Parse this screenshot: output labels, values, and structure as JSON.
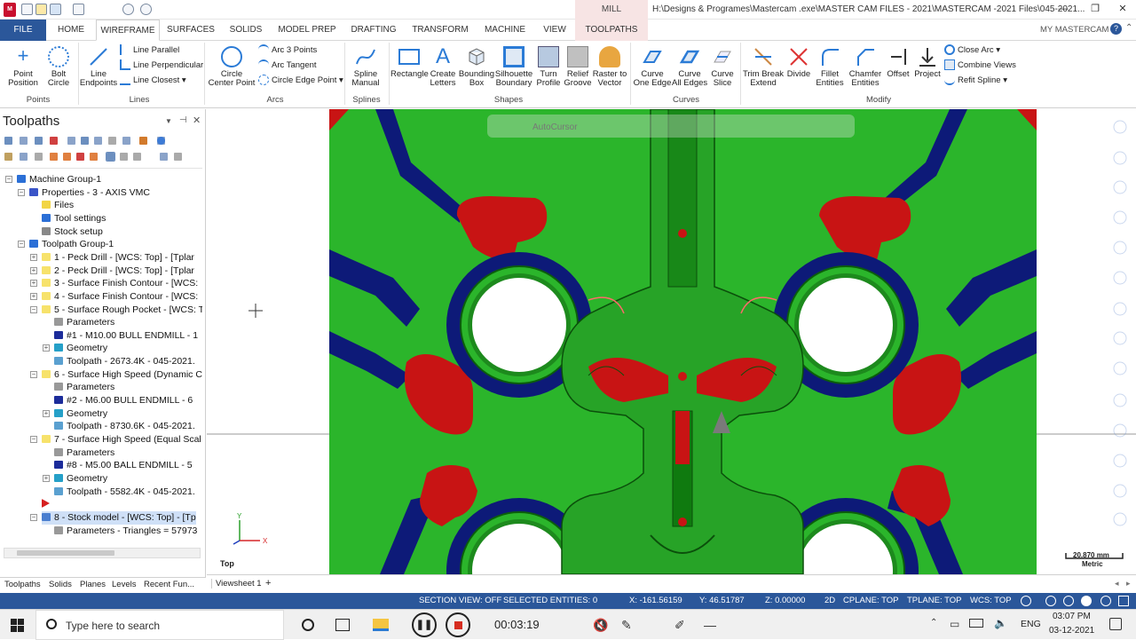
{
  "window": {
    "context_tab": "MILL",
    "title": "H:\\Designs & Programes\\Mastercam .exe\\MASTER CAM FILES - 2021\\MASTERCAM   -2021 Files\\045-2021...",
    "my_mastercam": "MY MASTERCAM"
  },
  "tabs": [
    "FILE",
    "HOME",
    "WIREFRAME",
    "SURFACES",
    "SOLIDS",
    "MODEL PREP",
    "DRAFTING",
    "TRANSFORM",
    "MACHINE",
    "VIEW",
    "TOOLPATHS"
  ],
  "ribbon": {
    "points": {
      "point_position": "Point\nPosition",
      "bolt_circle": "Bolt\nCircle",
      "group": "Points"
    },
    "lines": {
      "line_endpoints": "Line\nEndpoints",
      "line_parallel": "Line Parallel",
      "line_perpendicular": "Line Perpendicular",
      "line_closest": "Line Closest",
      "group": "Lines"
    },
    "arcs": {
      "circle_center_point": "Circle\nCenter Point",
      "arc_3_points": "Arc 3 Points",
      "arc_tangent": "Arc Tangent",
      "circle_edge_point": "Circle Edge Point",
      "group": "Arcs"
    },
    "splines": {
      "spline_manual": "Spline\nManual",
      "group": "Splines"
    },
    "shapes": {
      "rectangle": "Rectangle",
      "create_letters": "Create\nLetters",
      "bounding_box": "Bounding\nBox",
      "silhouette_boundary": "Silhouette\nBoundary",
      "turn_profile": "Turn\nProfile",
      "relief_groove": "Relief\nGroove",
      "raster_to_vector": "Raster to\nVector",
      "group": "Shapes"
    },
    "curves": {
      "curve_one_edge": "Curve\nOne Edge",
      "curve_all_edges": "Curve\nAll Edges",
      "curve_slice": "Curve\nSlice",
      "group": "Curves"
    },
    "modify": {
      "trim_break_extend": "Trim Break\nExtend",
      "divide": "Divide",
      "fillet_entities": "Fillet\nEntities",
      "chamfer_entities": "Chamfer\nEntities",
      "offset": "Offset",
      "project": "Project",
      "close_arc": "Close Arc",
      "combine_views": "Combine Views",
      "refit_spline": "Refit Spline",
      "group": "Modify"
    }
  },
  "panel": {
    "title": "Toolpaths",
    "tree": [
      {
        "label": "Machine Group-1",
        "indent": 0
      },
      {
        "label": "Properties - 3 - AXIS VMC",
        "indent": 1
      },
      {
        "label": "Files",
        "indent": 2
      },
      {
        "label": "Tool settings",
        "indent": 2
      },
      {
        "label": "Stock setup",
        "indent": 2
      },
      {
        "label": "Toolpath Group-1",
        "indent": 1
      },
      {
        "label": "1 - Peck Drill - [WCS: Top] - [Tplar",
        "indent": 2
      },
      {
        "label": "2 - Peck Drill - [WCS: Top] - [Tplar",
        "indent": 2
      },
      {
        "label": "3 - Surface Finish Contour - [WCS:",
        "indent": 2
      },
      {
        "label": "4 - Surface Finish Contour - [WCS:",
        "indent": 2
      },
      {
        "label": "5 - Surface Rough Pocket - [WCS: T",
        "indent": 2
      },
      {
        "label": "Parameters",
        "indent": 3
      },
      {
        "label": "#1 - M10.00 BULL ENDMILL - 1",
        "indent": 3
      },
      {
        "label": "Geometry",
        "indent": 3
      },
      {
        "label": "Toolpath - 2673.4K - 045-2021.",
        "indent": 3
      },
      {
        "label": "6 - Surface High Speed (Dynamic C",
        "indent": 2
      },
      {
        "label": "Parameters",
        "indent": 3
      },
      {
        "label": "#2 - M6.00 BULL ENDMILL - 6",
        "indent": 3
      },
      {
        "label": "Geometry",
        "indent": 3
      },
      {
        "label": "Toolpath - 8730.6K - 045-2021.",
        "indent": 3
      },
      {
        "label": "7 - Surface High Speed (Equal Scal",
        "indent": 2
      },
      {
        "label": "Parameters",
        "indent": 3
      },
      {
        "label": "#8 - M5.00 BALL ENDMILL - 5",
        "indent": 3
      },
      {
        "label": "Geometry",
        "indent": 3
      },
      {
        "label": "Toolpath - 5582.4K - 045-2021.",
        "indent": 3
      },
      {
        "label": "",
        "indent": 2
      },
      {
        "label": "8 - Stock model - [WCS: Top] - [Tp",
        "indent": 2
      },
      {
        "label": "Parameters - Triangles = 57973",
        "indent": 3
      }
    ],
    "bottom_tabs": [
      "Toolpaths",
      "Solids",
      "Planes",
      "Levels",
      "Recent Fun..."
    ]
  },
  "viewport": {
    "view_label": "Top",
    "autocursor": "AutoCursor",
    "axis_x": "X",
    "axis_y": "Y",
    "scale_value": "20.870 mm",
    "scale_unit": "Metric",
    "colors": {
      "green": "#2bb52b",
      "navy": "#0d1a78",
      "red": "#c81414",
      "white": "#ffffff"
    }
  },
  "sheet_tabs": {
    "tab": "Viewsheet 1",
    "add": "+"
  },
  "status": {
    "section_view": "SECTION VIEW: OFF",
    "selected": "SELECTED ENTITIES: 0",
    "x": "X:   -161.56159",
    "y": "Y:   46.51787",
    "z": "Z:   0.00000",
    "mode": "2D",
    "cplane": "CPLANE: TOP",
    "tplane": "TPLANE: TOP",
    "wcs": "WCS: TOP"
  },
  "taskbar": {
    "search_placeholder": "Type here to search",
    "timer": "00:03:19",
    "lang": "ENG",
    "time": "03:07 PM",
    "date": "03-12-2021"
  }
}
